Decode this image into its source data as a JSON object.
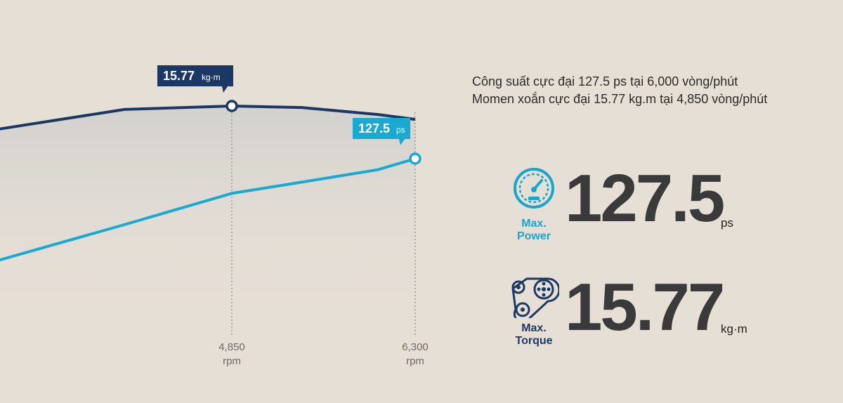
{
  "chart_data": {
    "type": "line",
    "xlabel": "",
    "ylabel": "",
    "x_tick_labels": [
      {
        "value": 4850,
        "line1": "4,850",
        "line2": "rpm"
      },
      {
        "value": 6300,
        "line1": "6,300",
        "line2": "rpm"
      }
    ],
    "series": [
      {
        "color": "#1b3763",
        "unit": "kg·m",
        "points": [
          [
            1200,
            14.2
          ],
          [
            2000,
            14.6
          ],
          [
            3000,
            15.3
          ],
          [
            4000,
            15.7
          ],
          [
            4850,
            15.77
          ],
          [
            5400,
            15.74
          ],
          [
            6000,
            15.6
          ],
          [
            6300,
            15.5
          ]
        ]
      },
      {
        "color": "#1aa9d1",
        "unit": "ps",
        "points": [
          [
            1200,
            55
          ],
          [
            2000,
            66
          ],
          [
            3000,
            82
          ],
          [
            4000,
            98
          ],
          [
            4850,
            112
          ],
          [
            5400,
            117
          ],
          [
            6000,
            122.5
          ],
          [
            6300,
            127.5
          ]
        ]
      }
    ],
    "annotations": [
      {
        "series": 0,
        "x": 4850,
        "value_label": "15.77",
        "unit_label": "kg·m",
        "color": "#1b3763"
      },
      {
        "series": 1,
        "x": 6300,
        "value_label": "127.5",
        "unit_label": "ps",
        "color": "#1aa9d1"
      }
    ]
  },
  "notes": {
    "line1": "Công suất cực đại 127.5 ps tại 6,000 vòng/phút",
    "line2": "Momen xoắn cực đại 15.77 kg.m tại 4,850 vòng/phút"
  },
  "power": {
    "icon": "speedometer-icon",
    "label_line1": "Max.",
    "label_line2": "Power",
    "value": "127.5",
    "unit": "ps",
    "color": "#19a6cc"
  },
  "torque": {
    "icon": "pulley-belt-icon",
    "label_line1": "Max.",
    "label_line2": "Torque",
    "value": "15.77",
    "unit": "kg·m",
    "color": "#1c3a63"
  }
}
